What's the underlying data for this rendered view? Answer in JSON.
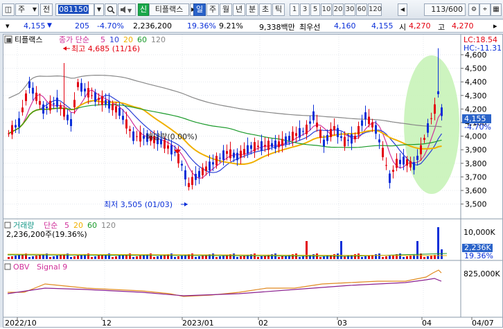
{
  "toolbar": {
    "menu_glyph": "◫",
    "market_label": "주",
    "prev_label": "전",
    "code": "081150",
    "new_badge": "신",
    "name": "티플랙스",
    "period_tabs": [
      "일",
      "주",
      "월",
      "년",
      "분",
      "초",
      "틱"
    ],
    "interval_buttons": [
      "1",
      "3",
      "5",
      "10",
      "20",
      "30",
      "60",
      "120"
    ],
    "page_counter": "113/600",
    "selected_period": "일"
  },
  "quote": {
    "price": "4,155",
    "change": "205",
    "change_pct": "-4.70%",
    "volume": "2,236,200",
    "turnover_pct": "19.36%",
    "ratio": "9.21%",
    "amount": "9,338백만",
    "best_ask_label": "최우선",
    "best_ask": "4,160",
    "best_bid": "4,155",
    "open_label": "시",
    "open": "4,270",
    "high_label": "고",
    "high": "4,270"
  },
  "price_panel": {
    "stock_name": "티플랙스",
    "ma_label": "종가 단순",
    "ma_periods": [
      "5",
      "10",
      "20",
      "60",
      "120"
    ],
    "ma_colors": [
      "#d0309a",
      "#2a3fd6",
      "#f0b000",
      "#1a9a2a",
      "#888888"
    ],
    "lc_label": "LC:18.54",
    "hc_label": "HC:-11.31",
    "high_marker": "최고 4,685 (11/16)",
    "low_marker": "최저 3,505 (01/03)",
    "dividend_label": "배당락(0.00%)",
    "current_price_tag": "4,155",
    "current_change_tag": "-4.70%",
    "y_ticks": [
      "4,600",
      "4,500",
      "4,400",
      "4,300",
      "4,200",
      "4,100",
      "4,000",
      "3,900",
      "3,800",
      "3,700",
      "3,600",
      "3,500"
    ]
  },
  "volume_panel": {
    "label": "거래량",
    "ma_label": "단순",
    "ma_periods": [
      "5",
      "20",
      "60",
      "120"
    ],
    "ma_colors": [
      "#d0309a",
      "#f0b000",
      "#1a9a2a",
      "#888888"
    ],
    "value_text": "2,236,200주(19.36%)",
    "y_tick": "10,000K",
    "current_tag": "2,236K",
    "current_pct_tag": "19.36%"
  },
  "obv_panel": {
    "label": "OBV",
    "signal_label": "Signal 9",
    "y_tick": "825,000K"
  },
  "x_axis": {
    "labels": [
      "2022/10",
      "12",
      "2023/01",
      "02",
      "03",
      "04",
      "04/07"
    ]
  },
  "colors": {
    "up": "#e3000f",
    "down": "#0a2fd8",
    "highlight_ellipse": "#b8f0a8"
  }
}
